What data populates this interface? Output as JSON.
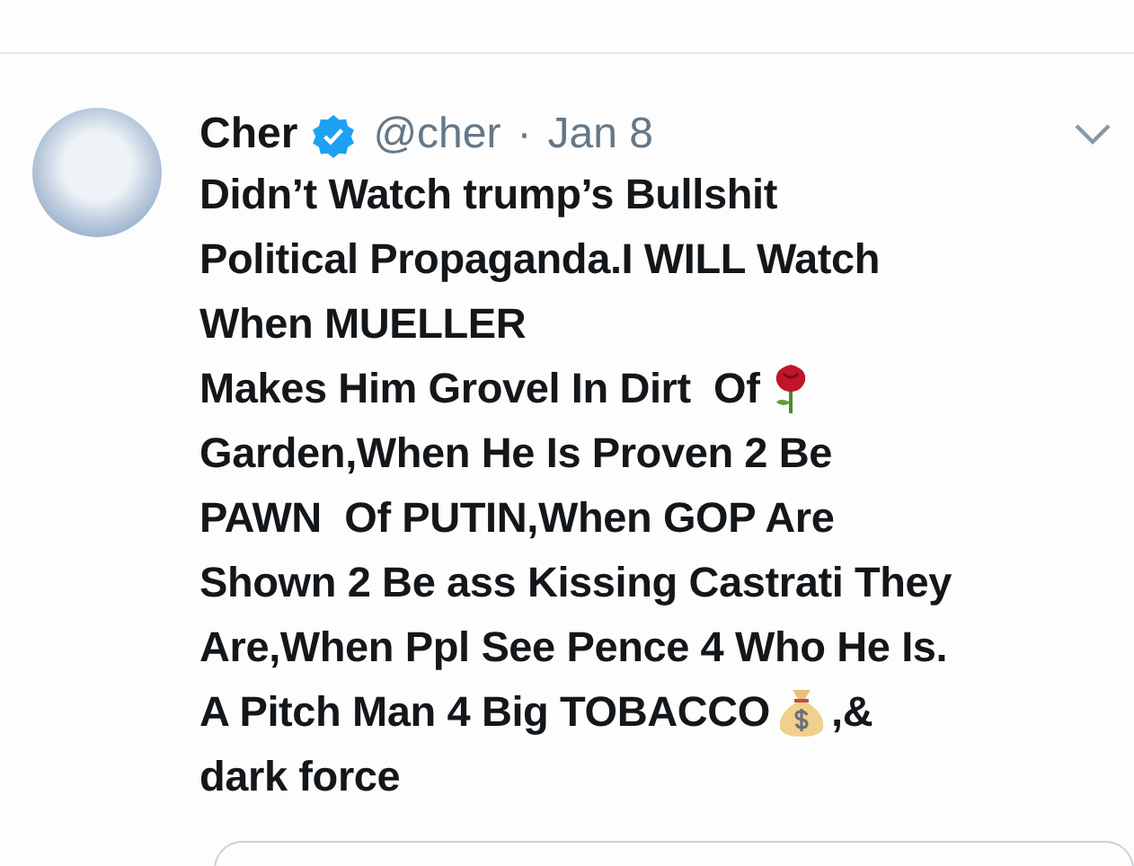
{
  "tweet": {
    "name": "Cher",
    "verified": true,
    "handle": "@cher",
    "separator": "·",
    "date": "Jan 8",
    "lines": [
      [
        {
          "kind": "text",
          "text": "Didn’t Watch trump’s Bullshit"
        }
      ],
      [
        {
          "kind": "text",
          "text": "Political Propaganda.I WILL Watch"
        }
      ],
      [
        {
          "kind": "text",
          "text": "When MUELLER"
        }
      ],
      [
        {
          "kind": "text",
          "text": "Makes Him Grovel In Dirt  Of"
        },
        {
          "kind": "flower"
        }
      ],
      [
        {
          "kind": "text",
          "text": "Garden,When He Is Proven 2 Be"
        }
      ],
      [
        {
          "kind": "text",
          "text": "PAWN  Of PUTIN,When GOP Are"
        }
      ],
      [
        {
          "kind": "text",
          "text": "Shown 2 Be ass Kissing Castrati They"
        }
      ],
      [
        {
          "kind": "text",
          "text": "Are,When Ppl See Pence 4 Who He Is."
        }
      ],
      [
        {
          "kind": "text",
          "text": "A Pitch Man 4 Big TOBACCO"
        },
        {
          "kind": "bag"
        },
        {
          "kind": "text",
          "text": ",&"
        }
      ],
      [
        {
          "kind": "text",
          "text": "dark force"
        }
      ]
    ]
  }
}
